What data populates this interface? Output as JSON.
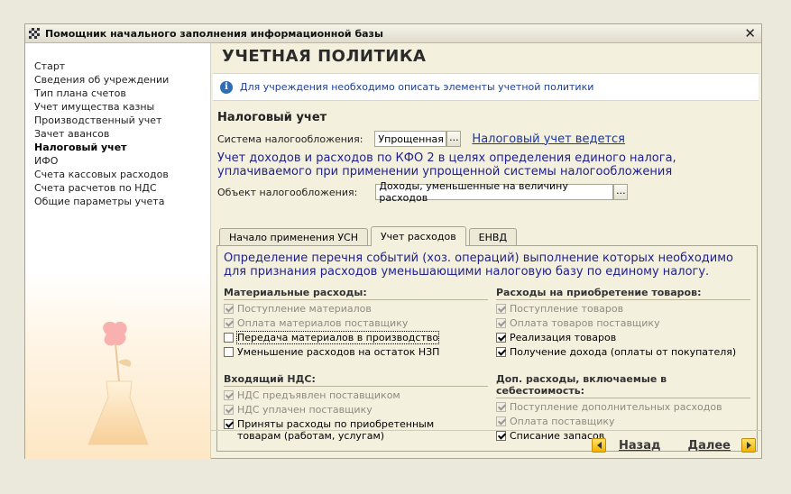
{
  "window": {
    "title": "Помощник начального заполнения информационной базы",
    "close_symbol": "✕"
  },
  "sidebar": {
    "items": [
      {
        "label": "Старт"
      },
      {
        "label": "Сведения об учреждении"
      },
      {
        "label": "Тип плана счетов"
      },
      {
        "label": "Учет имущества казны"
      },
      {
        "label": "Производственный учет"
      },
      {
        "label": "Зачет авансов"
      },
      {
        "label": "Налоговый учет",
        "active": true
      },
      {
        "label": "ИФО"
      },
      {
        "label": "Счета кассовых расходов"
      },
      {
        "label": "Счета расчетов по НДС"
      },
      {
        "label": "Общие параметры учета"
      }
    ]
  },
  "main": {
    "page_title": "УЧЕТНАЯ ПОЛИТИКА",
    "info_icon": "i",
    "info_text": "Для учреждения необходимо описать элементы учетной политики",
    "section_title": "Налоговый учет",
    "tax_system_label": "Система налогообложения:",
    "tax_system_value": "Упрощенная",
    "tax_link": "Налоговый учет ведется",
    "kfo_text": "Учет доходов и расходов по КФО 2 в целях определения единого налога, уплачиваемого при применении упрощенной системы налогообложения",
    "object_label": "Объект налогообложения:",
    "object_value": "Доходы, уменьшенные на величину расходов",
    "dots": "...",
    "tabs": [
      {
        "label": "Начало применения УСН"
      },
      {
        "label": "Учет расходов",
        "active": true
      },
      {
        "label": "ЕНВД"
      }
    ],
    "panel": {
      "description": "Определение перечня событий (хоз. операций) выполнение которых необходимо для признания расходов уменьшающими налоговую базу по единому налогу.",
      "groups": {
        "material": {
          "title": "Материальные расходы:",
          "items": [
            {
              "label": "Поступление материалов",
              "checked": true,
              "disabled": true
            },
            {
              "label": "Оплата материалов поставщику",
              "checked": true,
              "disabled": true
            },
            {
              "label": "Передача материалов в производство",
              "checked": false,
              "disabled": false,
              "focused": true
            },
            {
              "label": "Уменьшение расходов на остаток НЗП",
              "checked": false,
              "disabled": false
            }
          ]
        },
        "vat": {
          "title": "Входящий НДС:",
          "items": [
            {
              "label": "НДС предъявлен поставщиком",
              "checked": true,
              "disabled": true
            },
            {
              "label": "НДС уплачен поставщику",
              "checked": true,
              "disabled": true
            },
            {
              "label": "Приняты расходы по приобретенным товарам (работам, услугам)",
              "checked": true,
              "disabled": false
            }
          ]
        },
        "goods": {
          "title": "Расходы на приобретение товаров:",
          "items": [
            {
              "label": "Поступление товаров",
              "checked": true,
              "disabled": true
            },
            {
              "label": "Оплата товаров поставщику",
              "checked": true,
              "disabled": true
            },
            {
              "label": "Реализация товаров",
              "checked": true,
              "disabled": false
            },
            {
              "label": "Получение дохода (оплаты от покупателя)",
              "checked": true,
              "disabled": false
            }
          ]
        },
        "extra": {
          "title": "Доп. расходы, включаемые в себестоимость:",
          "items": [
            {
              "label": "Поступление дополнительных расходов",
              "checked": true,
              "disabled": true
            },
            {
              "label": "Оплата поставщику",
              "checked": true,
              "disabled": true
            },
            {
              "label": "Списание запасов",
              "checked": true,
              "disabled": false
            }
          ]
        }
      }
    }
  },
  "footer": {
    "back_label": "Назад",
    "next_label": "Далее"
  },
  "colors": {
    "accent_blue": "#1a34a8",
    "window_bg": "#f3f0de",
    "arrow_yellow": "#f2b200"
  }
}
